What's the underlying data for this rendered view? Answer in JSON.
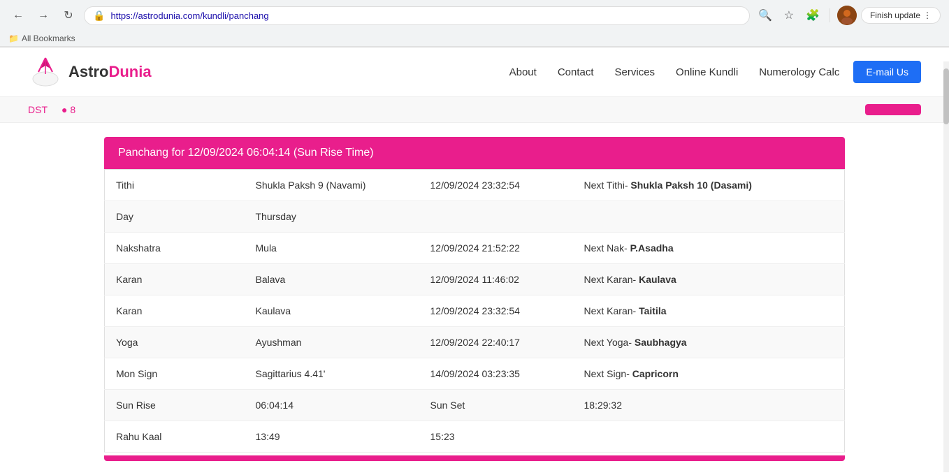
{
  "browser": {
    "url": "https://astrodunia.com/kundli/panchang",
    "finish_update_label": "Finish update",
    "bookmarks_label": "All Bookmarks"
  },
  "navbar": {
    "logo": "AstroDunia",
    "logo_astro": "Astro",
    "logo_dunia": "Dunia",
    "links": [
      {
        "label": "About"
      },
      {
        "label": "Contact"
      },
      {
        "label": "Services"
      },
      {
        "label": "Online Kundli"
      },
      {
        "label": "Numerology Calc"
      }
    ],
    "email_button": "E-mail Us"
  },
  "banner": {
    "text": "DST",
    "button_label": ""
  },
  "panchang": {
    "header": "Panchang for 12/09/2024 06:04:14 (Sun Rise Time)",
    "rows": [
      {
        "label": "Tithi",
        "value": "Shukla Paksh 9 (Navami)",
        "date": "12/09/2024 23:32:54",
        "next": "Next Tithi-",
        "next_bold": "Shukla Paksh 10 (Dasami)"
      },
      {
        "label": "Day",
        "value": "Thursday",
        "date": "",
        "next": "",
        "next_bold": ""
      },
      {
        "label": "Nakshatra",
        "value": "Mula",
        "date": "12/09/2024 21:52:22",
        "next": "Next Nak-",
        "next_bold": "P.Asadha"
      },
      {
        "label": "Karan",
        "value": "Balava",
        "date": "12/09/2024 11:46:02",
        "next": "Next Karan-",
        "next_bold": "Kaulava"
      },
      {
        "label": "Karan",
        "value": "Kaulava",
        "date": "12/09/2024 23:32:54",
        "next": "Next Karan-",
        "next_bold": "Taitila"
      },
      {
        "label": "Yoga",
        "value": "Ayushman",
        "date": "12/09/2024 22:40:17",
        "next": "Next Yoga-",
        "next_bold": "Saubhagya"
      },
      {
        "label": "Mon Sign",
        "value": "Sagittarius 4.41'",
        "date": "14/09/2024 03:23:35",
        "next": "Next Sign-",
        "next_bold": "Capricorn"
      },
      {
        "label": "Sun Rise",
        "value": "06:04:14",
        "date_label": "Sun Set",
        "date": "18:29:32",
        "next": "",
        "next_bold": ""
      },
      {
        "label": "Rahu Kaal",
        "value": "13:49",
        "date": "15:23",
        "next": "",
        "next_bold": ""
      }
    ]
  }
}
